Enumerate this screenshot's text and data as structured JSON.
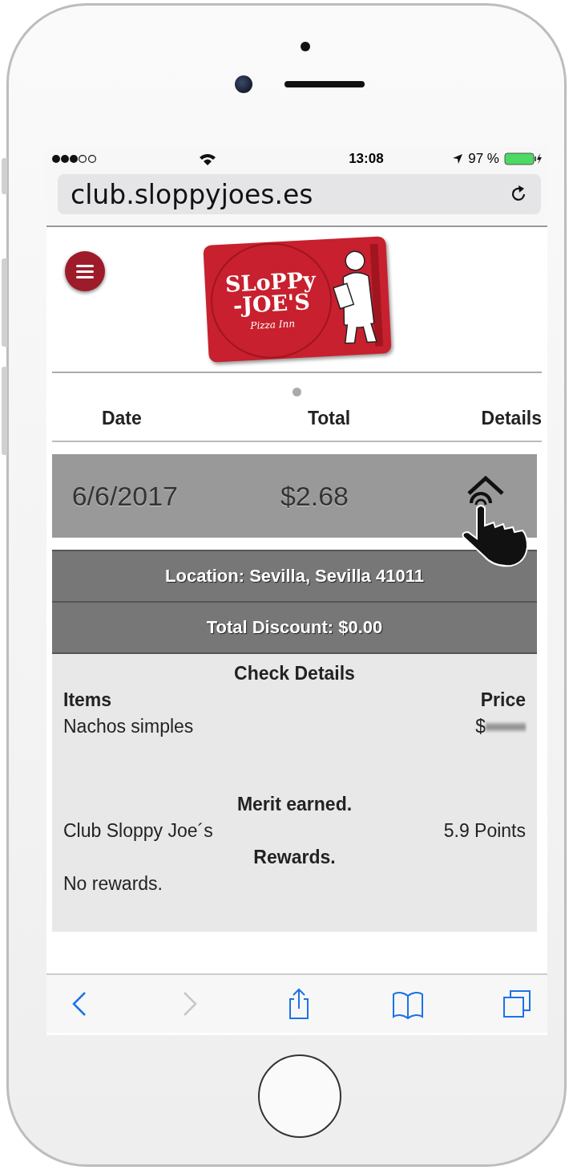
{
  "status_bar": {
    "time": "13:08",
    "battery": "97 %"
  },
  "address_bar": {
    "url": "club.sloppyjoes.es"
  },
  "logo": {
    "line_1": "SLoPPy",
    "line_2": "-JOE'S",
    "tagline": "Pizza Inn"
  },
  "columns": [
    "Date",
    "Total",
    "Details"
  ],
  "record": {
    "date": "6/6/2017",
    "total": "$2.68",
    "expanded": true
  },
  "location": "Location: Sevilla, Sevilla 41011",
  "discount": "Total Discount: $0.00",
  "check_details": {
    "title": "Check Details",
    "items_heading": "Items",
    "price_heading": "Price",
    "items": [
      {
        "name": "Nachos simples",
        "price": "$"
      }
    ],
    "merit_title": "Merit earned.",
    "merits": [
      {
        "name": "Club Sloppy Joe´s",
        "value": "5.9 Points"
      }
    ],
    "rewards_title": "Rewards.",
    "rewards_text": "No rewards."
  },
  "toolbar": [
    {
      "kind": "back",
      "disabled": false
    },
    {
      "kind": "forward",
      "disabled": true
    },
    {
      "kind": "share",
      "disabled": false
    },
    {
      "kind": "bookmarks",
      "disabled": false
    },
    {
      "kind": "tabs",
      "disabled": false
    }
  ]
}
